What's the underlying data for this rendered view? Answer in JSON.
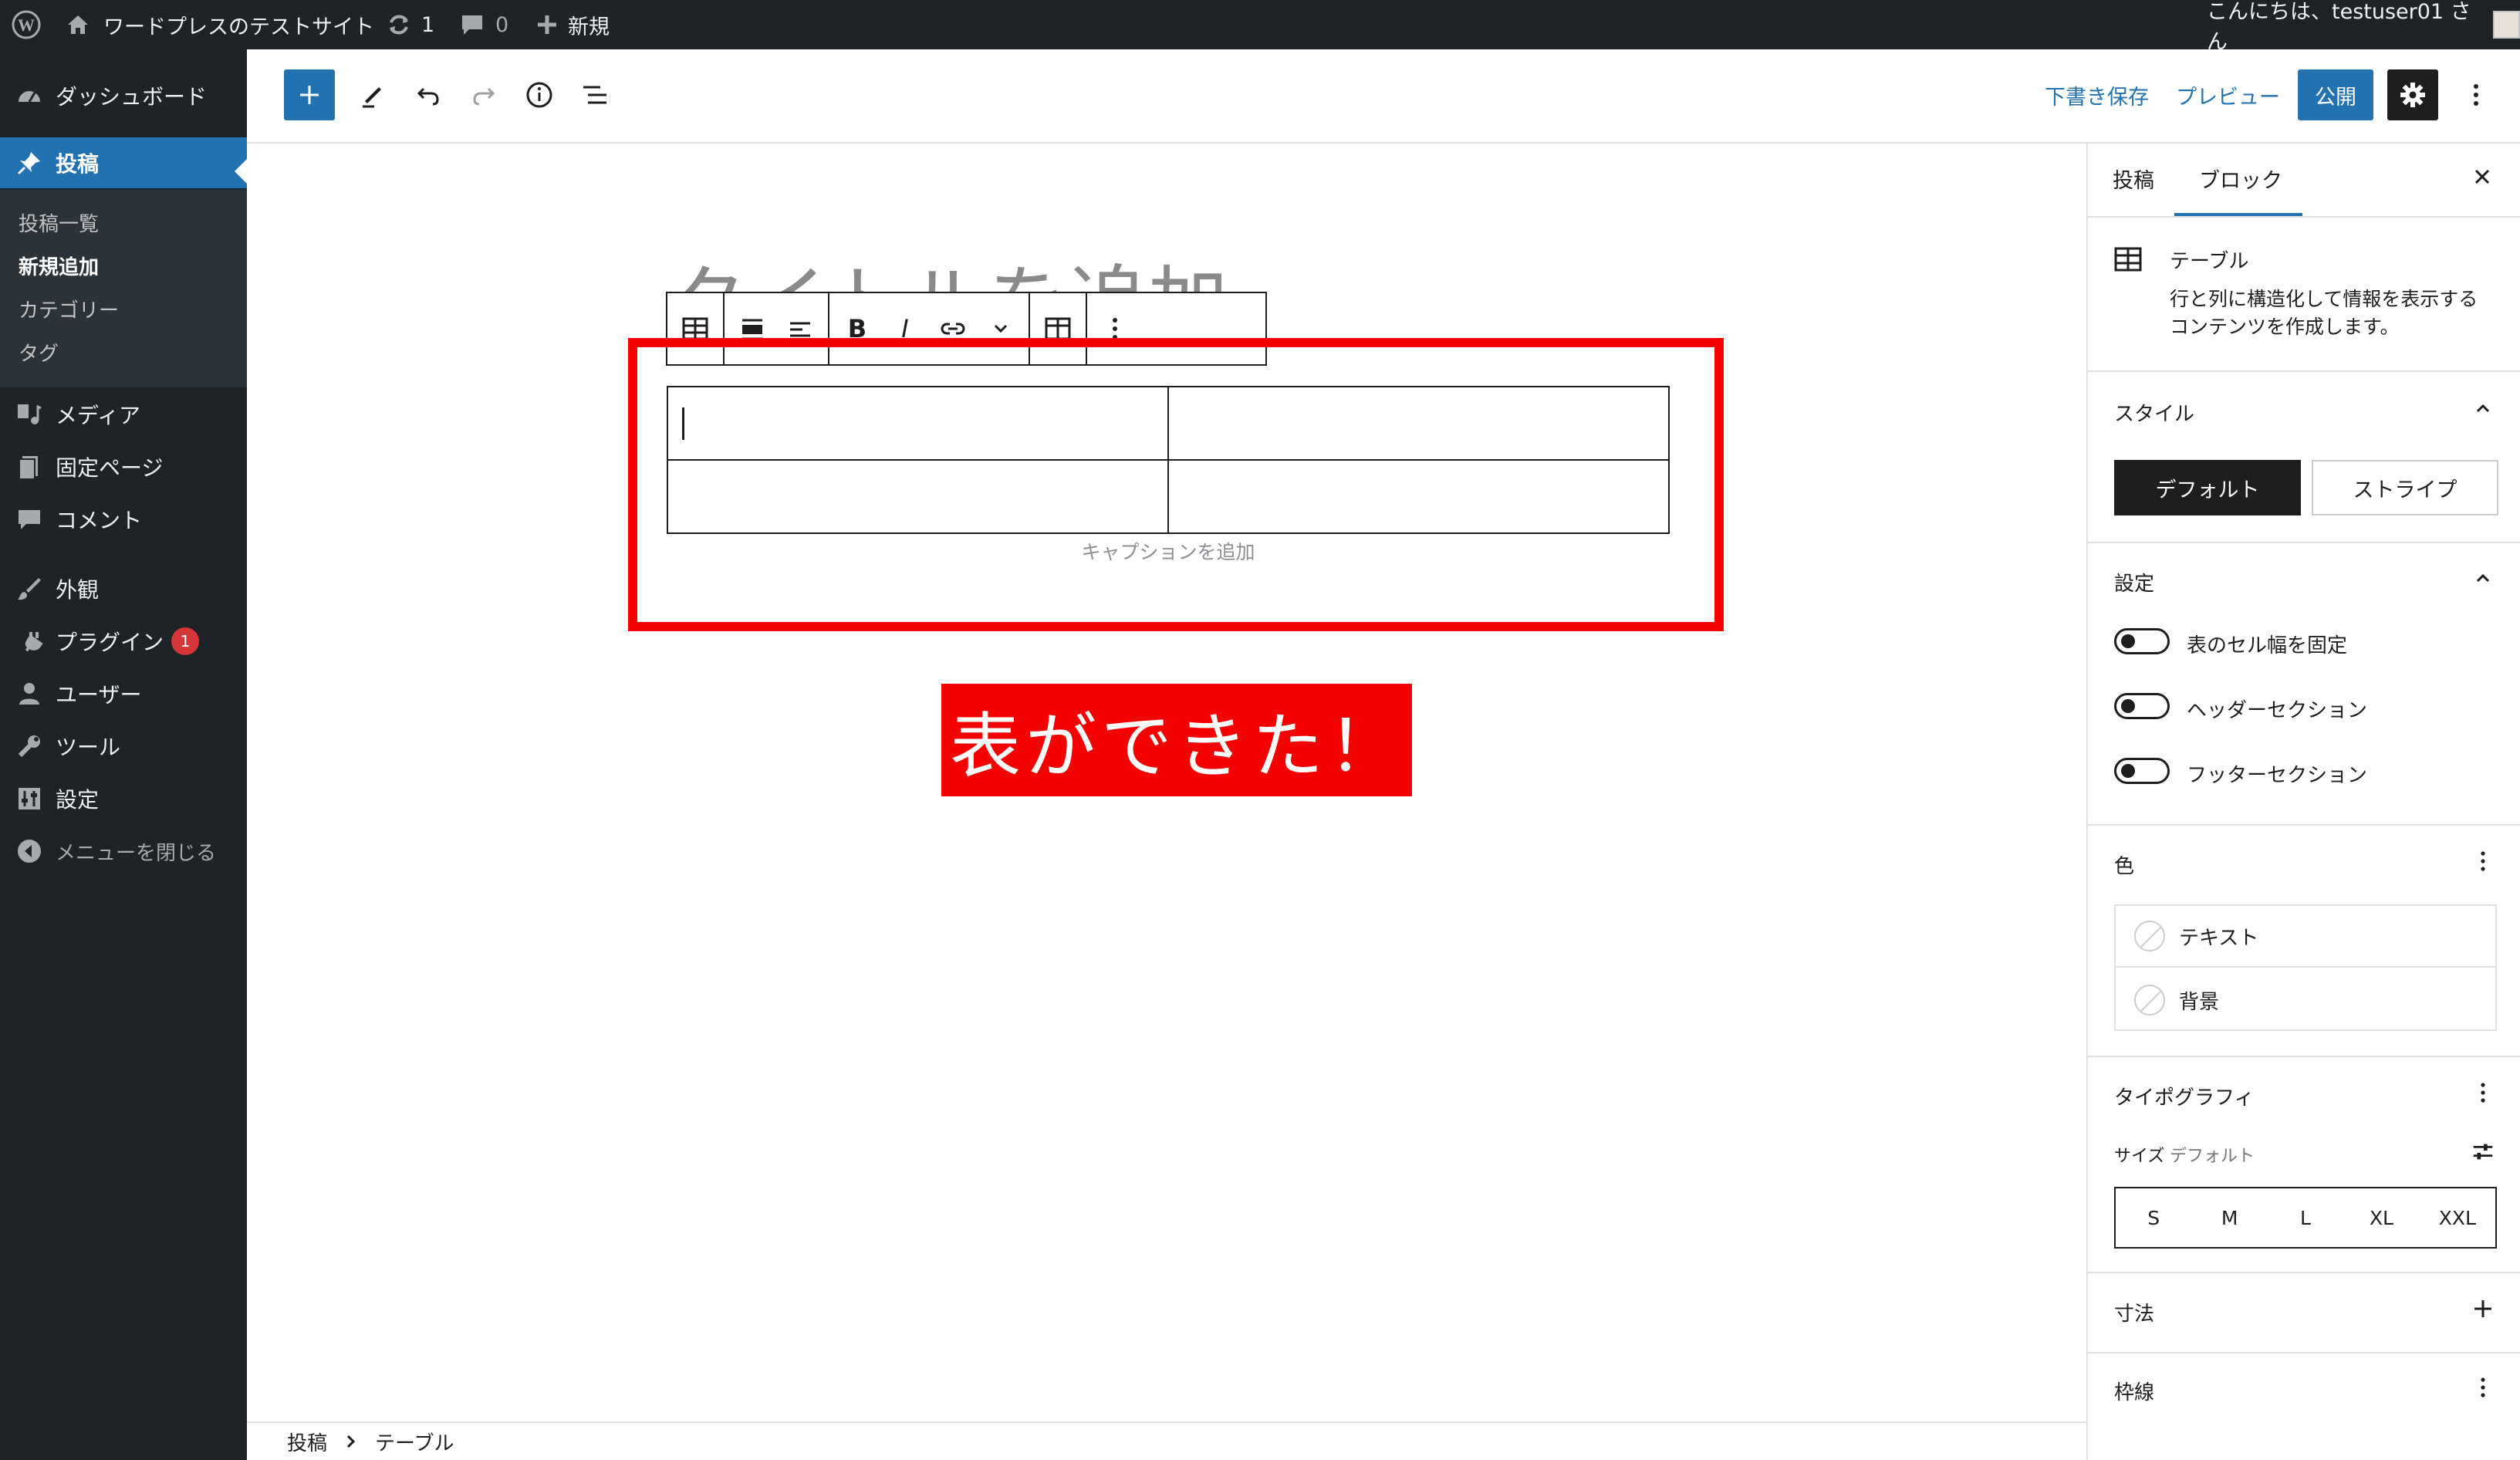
{
  "admin_bar": {
    "site_name": "ワードプレスのテストサイト",
    "updates_count": "1",
    "comments_count": "0",
    "new_label": "新規",
    "greeting": "こんにちは、testuser01 さん"
  },
  "admin_menu": {
    "dashboard": "ダッシュボード",
    "posts": "投稿",
    "posts_submenu": [
      "投稿一覧",
      "新規追加",
      "カテゴリー",
      "タグ"
    ],
    "media": "メディア",
    "pages": "固定ページ",
    "comments": "コメント",
    "appearance": "外観",
    "plugins": "プラグイン",
    "plugins_badge": "1",
    "users": "ユーザー",
    "tools": "ツール",
    "settings": "設定",
    "collapse": "メニューを閉じる"
  },
  "editor_toolbar": {
    "save_draft": "下書き保存",
    "preview": "プレビュー",
    "publish": "公開"
  },
  "canvas": {
    "title_placeholder": "タイトルを追加",
    "caption_placeholder": "キャプションを追加",
    "annotation": "表ができた！",
    "table_rows": 2,
    "table_cols": 2
  },
  "block_toolbar": {
    "bold": "B",
    "italic": "I"
  },
  "breadcrumb": [
    "投稿",
    "テーブル"
  ],
  "sidebar": {
    "tabs": [
      "投稿",
      "ブロック"
    ],
    "active_tab": "ブロック",
    "block_name": "テーブル",
    "block_description_lines": [
      "行と列に構造化して情報を表示する",
      "コンテンツを作成します。"
    ],
    "style_heading": "スタイル",
    "style_options": [
      "デフォルト",
      "ストライプ"
    ],
    "selected_style": "デフォルト",
    "settings_heading": "設定",
    "toggles": [
      {
        "label": "表のセル幅を固定",
        "on": false
      },
      {
        "label": "ヘッダーセクション",
        "on": false
      },
      {
        "label": "フッターセクション",
        "on": false
      }
    ],
    "color_heading": "色",
    "color_items": [
      "テキスト",
      "背景"
    ],
    "typography_heading": "タイポグラフィ",
    "size_label": "サイズ",
    "size_value": "デフォルト",
    "font_sizes": [
      "S",
      "M",
      "L",
      "XL",
      "XXL"
    ],
    "dimensions_heading": "寸法",
    "border_heading": "枠線"
  },
  "colors": {
    "admin_dark": "#1d2327",
    "accent": "#2271b1",
    "annotation_red": "#f50000"
  }
}
